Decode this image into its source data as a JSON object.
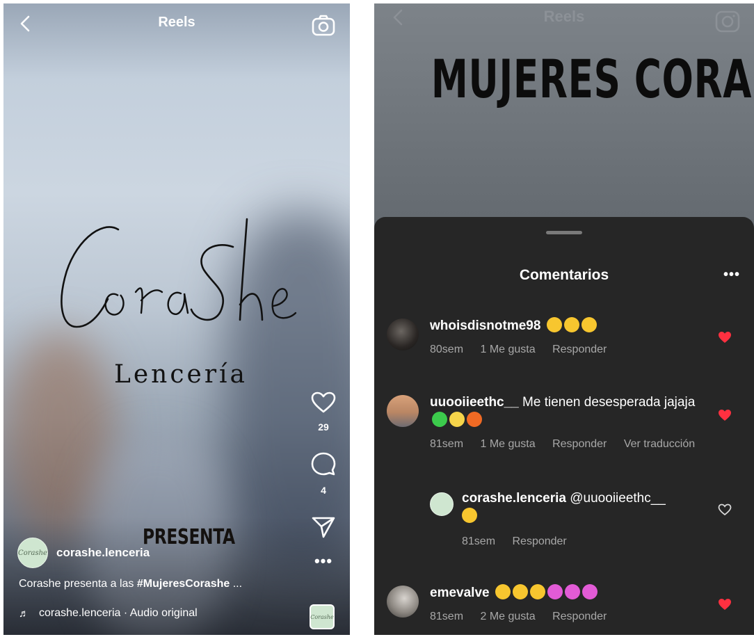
{
  "left": {
    "topbar": {
      "title": "Reels",
      "back_icon": "chevron-left-icon",
      "camera_icon": "camera-icon"
    },
    "logo": {
      "subtitle": "Lencería"
    },
    "overlay_text": "PRESENTA",
    "actions": {
      "likes": "29",
      "comments": "4"
    },
    "post": {
      "username": "corashe.lenceria",
      "caption_prefix": "Corashe presenta a las ",
      "caption_tag": "#MujeresCorashe",
      "caption_suffix": " ...",
      "audio": "corashe.lenceria · Audio original"
    }
  },
  "right": {
    "topbar": {
      "title": "Reels"
    },
    "headline": "MUJERES CORASHE",
    "sheet": {
      "title": "Comentarios"
    },
    "comments": [
      {
        "user": "whoisdisnotme98",
        "text": "",
        "emojis": [
          "heart-eyes",
          "heart-eyes",
          "heart-eyes"
        ],
        "age": "80sem",
        "likes": "1 Me gusta",
        "reply": "Responder",
        "liked": true
      },
      {
        "user": "uuooiieethc__",
        "text": "Me tienen desesperada jajaja",
        "emojis": [
          "green-heart",
          "sparkles",
          "fire"
        ],
        "age": "81sem",
        "likes": "1 Me gusta",
        "reply": "Responder",
        "translate": "Ver traducción",
        "liked": true
      },
      {
        "user": "corashe.lenceria",
        "mention": "@uuooiieethc__",
        "emojis": [
          "smiling-face-with-hearts"
        ],
        "age": "81sem",
        "reply": "Responder",
        "liked": false
      },
      {
        "user": "emevalve",
        "text": "",
        "emojis": [
          "star-struck",
          "star-struck",
          "star-struck",
          "revolving-hearts",
          "revolving-hearts",
          "revolving-hearts"
        ],
        "age": "81sem",
        "likes": "2 Me gusta",
        "reply": "Responder",
        "liked": true
      }
    ]
  },
  "colors": {
    "like_red": "#ff3040",
    "sheet_bg": "#262626",
    "meta_gray": "#a8a8a8"
  }
}
